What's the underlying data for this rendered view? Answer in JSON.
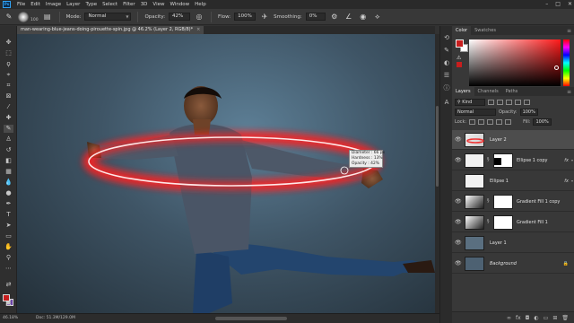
{
  "app": {
    "logo": "Ps",
    "menu": [
      "File",
      "Edit",
      "Image",
      "Layer",
      "Type",
      "Select",
      "Filter",
      "3D",
      "View",
      "Window",
      "Help"
    ],
    "window_controls": {
      "minimize": "–",
      "maximize": "□",
      "close": "✕"
    }
  },
  "options": {
    "tool_icon": "brush-icon",
    "brush_size": "100",
    "mode_label": "Mode:",
    "mode_value": "Normal",
    "opacity_label": "Opacity:",
    "opacity_value": "42%",
    "flow_label": "Flow:",
    "flow_value": "100%",
    "smoothing_label": "Smoothing:",
    "smoothing_value": "0%"
  },
  "document": {
    "tab_title": "man-wearing-blue-jeans-doing-pirouette-spin.jpg @ 46.2% (Layer 2, RGB/8)*",
    "close": "×"
  },
  "brush_tooltip": {
    "diameter": "Diameter :  66 px",
    "hardness": "Hardness :  13%",
    "opacity": "Opacity :  42%"
  },
  "status": {
    "zoom": "46.18%",
    "doc_size": "Doc: 51.3M/129.0M"
  },
  "colors": {
    "foreground": "#c81e1e",
    "background_swatch": "#5a2aa0",
    "accent": "#ff2a2a"
  },
  "color_panel": {
    "tabs": [
      "Color",
      "Swatches"
    ],
    "active_tab": "Color"
  },
  "layers_panel": {
    "tabs": [
      "Layers",
      "Channels",
      "Paths"
    ],
    "active_tab": "Layers",
    "filter_kind": "Kind",
    "blend_mode": "Normal",
    "opacity_label": "Opacity:",
    "opacity_value": "100%",
    "lock_label": "Lock:",
    "fill_label": "Fill:",
    "fill_value": "100%",
    "layers": [
      {
        "name": "Layer 2",
        "selected": true,
        "visible": true,
        "fx": ""
      },
      {
        "name": "Ellipse 1 copy",
        "selected": false,
        "visible": true,
        "fx": "fx"
      },
      {
        "name": "Ellipse 1",
        "selected": false,
        "visible": false,
        "fx": "fx"
      },
      {
        "name": "Gradient Fill 1 copy",
        "selected": false,
        "visible": true,
        "fx": ""
      },
      {
        "name": "Gradient Fill 1",
        "selected": false,
        "visible": true,
        "fx": ""
      },
      {
        "name": "Layer 1",
        "selected": false,
        "visible": true,
        "fx": ""
      },
      {
        "name": "Background",
        "selected": false,
        "visible": true,
        "fx": ""
      }
    ]
  }
}
